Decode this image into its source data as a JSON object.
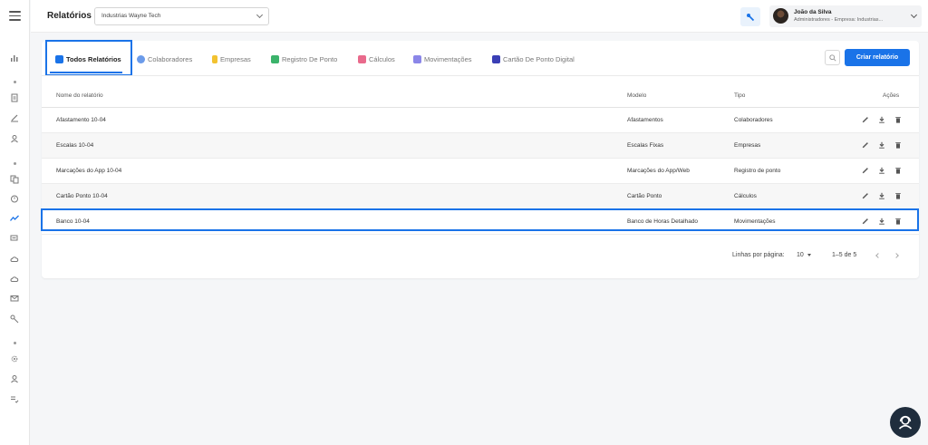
{
  "header": {
    "title": "Relatórios",
    "company_select": "Industrias Wayne Tech",
    "user": {
      "name": "João da Silva",
      "role": "Administradores - Empresa: Industrias..."
    }
  },
  "tabs": [
    {
      "label": "Todos Relatórios",
      "icon": "reports-icon",
      "color": "#1a73e8"
    },
    {
      "label": "Colaboradores",
      "icon": "users-icon",
      "color": "#6b9bea"
    },
    {
      "label": "Empresas",
      "icon": "company-icon",
      "color": "#f2c230"
    },
    {
      "label": "Registro De Ponto",
      "icon": "clock-record-icon",
      "color": "#3bb36b"
    },
    {
      "label": "Cálculos",
      "icon": "calculator-icon",
      "color": "#e96a8c"
    },
    {
      "label": "Movimentações",
      "icon": "movements-icon",
      "color": "#8b86e8"
    },
    {
      "label": "Cartão De Ponto Digital",
      "icon": "digital-card-icon",
      "color": "#3a3fb5"
    }
  ],
  "create_button": "Criar relatório",
  "table": {
    "columns": [
      "Nome do relatório",
      "Modelo",
      "Tipo",
      "Ações"
    ],
    "rows": [
      {
        "name": "Afastamento 10-04",
        "model": "Afastamentos",
        "type": "Colaboradores"
      },
      {
        "name": "Escalas 10-04",
        "model": "Escalas Fixas",
        "type": "Empresas"
      },
      {
        "name": "Marcações do App 10-04",
        "model": "Marcações do App/Web",
        "type": "Registro de ponto"
      },
      {
        "name": "Cartão Ponto 10-04",
        "model": "Cartão Ponto",
        "type": "Cálculos"
      },
      {
        "name": "Banco 10-04",
        "model": "Banco de Horas Detalhado",
        "type": "Movimentações"
      }
    ]
  },
  "pagination": {
    "rows_label": "Linhas por página:",
    "rows_value": "10",
    "range": "1–5 de 5"
  },
  "colors": {
    "accent": "#1a73e8",
    "fab": "#1f2d3d"
  }
}
